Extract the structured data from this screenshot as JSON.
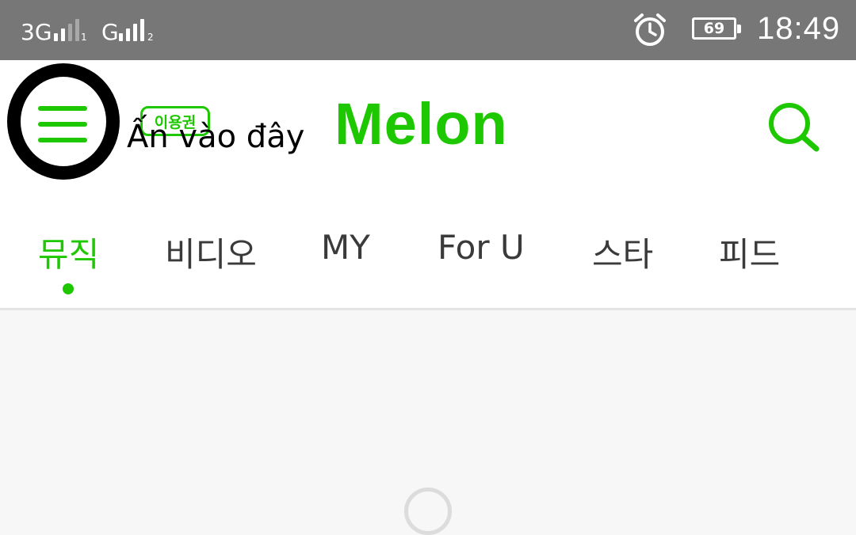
{
  "status_bar": {
    "sim1_network": "3G",
    "sim1_index": "1",
    "sim2_network": "G",
    "sim2_index": "2",
    "battery_level": "69",
    "time": "18:49",
    "icons": [
      "signal-icon",
      "alarm-clock-icon",
      "battery-icon"
    ]
  },
  "header": {
    "ticket_badge": "이용권",
    "logo": "Melon",
    "icons": [
      "hamburger-menu-icon",
      "search-icon"
    ]
  },
  "annotation": {
    "text": "Ấn vào đây"
  },
  "tabs": [
    {
      "label": "뮤직",
      "active": true
    },
    {
      "label": "비디오",
      "active": false
    },
    {
      "label": "MY",
      "active": false
    },
    {
      "label": "For U",
      "active": false
    },
    {
      "label": "스타",
      "active": false
    },
    {
      "label": "피드",
      "active": false
    }
  ],
  "colors": {
    "brand_green": "#1ec800",
    "status_bar": "#777777",
    "text_dark": "#3a3a3a"
  }
}
